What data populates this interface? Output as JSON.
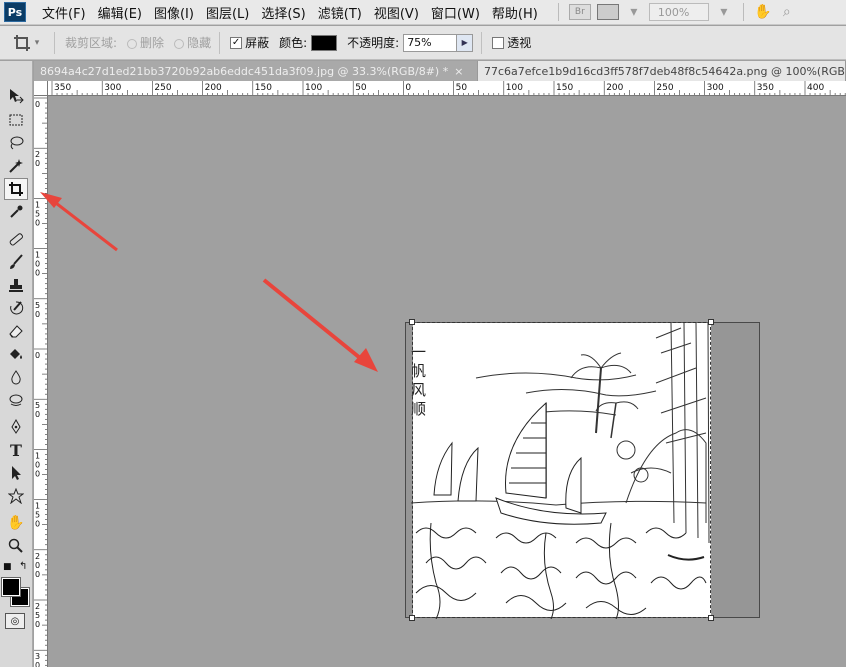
{
  "app": {
    "logo": "Ps"
  },
  "menu": [
    {
      "label": "文件(F)"
    },
    {
      "label": "编辑(E)"
    },
    {
      "label": "图像(I)"
    },
    {
      "label": "图层(L)"
    },
    {
      "label": "选择(S)"
    },
    {
      "label": "滤镜(T)"
    },
    {
      "label": "视图(V)"
    },
    {
      "label": "窗口(W)"
    },
    {
      "label": "帮助(H)"
    }
  ],
  "menubar_right": {
    "bridge_label": "Br",
    "zoom": "100%"
  },
  "options": {
    "crop_area_label": "裁剪区域:",
    "delete_label": "删除",
    "hide_label": "隐藏",
    "shield_label": "屏蔽",
    "shield_checked": true,
    "color_label": "颜色:",
    "color_value": "#000000",
    "opacity_label": "不透明度:",
    "opacity_value": "75%",
    "perspective_label": "透视",
    "perspective_checked": false
  },
  "tabs": [
    {
      "label": "8694a4c27d1ed21bb3720b92ab6eddc451da3f09.jpg @ 33.3%(RGB/8#) *",
      "active": true
    },
    {
      "label": "77c6a7efce1b9d16cd3ff578f7deb48f8c54642a.png @ 100%(RGB",
      "active": false
    }
  ],
  "ruler": {
    "horizontal": [
      "350",
      "300",
      "250",
      "200",
      "150",
      "100",
      "50",
      "0",
      "50",
      "100",
      "150",
      "200",
      "250",
      "300",
      "350",
      "400"
    ],
    "vertical": [
      "0",
      "2 0",
      "1 5 0",
      "1 0 0",
      "5 0",
      "0",
      "5 0",
      "1 0 0",
      "1 5 0",
      "2 0 0",
      "2 5 0",
      "3 0"
    ]
  },
  "artwork": {
    "vertical_title": [
      "一",
      "帆",
      "风",
      "顺"
    ]
  },
  "swatches": {
    "foreground": "#000000",
    "background": "#000000"
  }
}
